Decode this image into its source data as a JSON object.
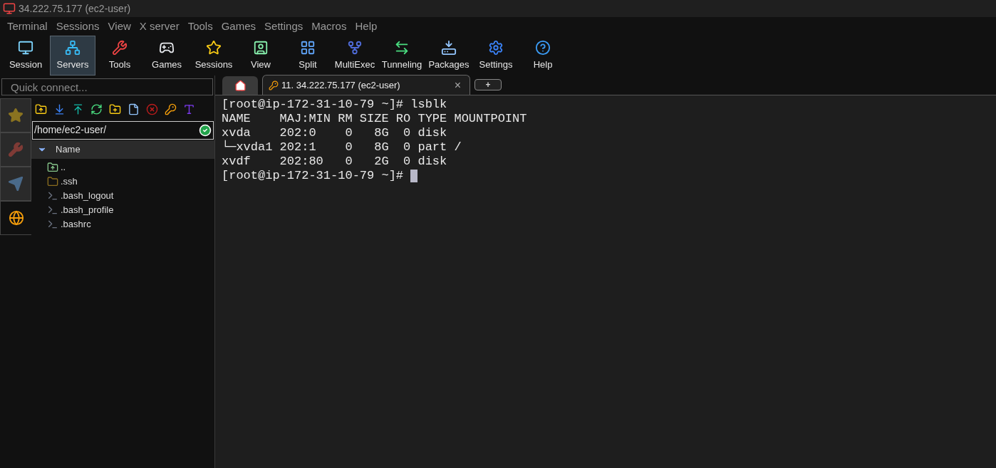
{
  "window": {
    "title": "34.222.75.177 (ec2-user)"
  },
  "menu": [
    "Terminal",
    "Sessions",
    "View",
    "X server",
    "Tools",
    "Games",
    "Settings",
    "Macros",
    "Help"
  ],
  "toolbar": [
    {
      "kind": "session",
      "label": "Session",
      "selected": false
    },
    {
      "kind": "servers",
      "label": "Servers",
      "selected": true
    },
    {
      "kind": "tools",
      "label": "Tools",
      "selected": false
    },
    {
      "kind": "games",
      "label": "Games",
      "selected": false
    },
    {
      "kind": "sessions",
      "label": "Sessions",
      "selected": false
    },
    {
      "kind": "view",
      "label": "View",
      "selected": false
    },
    {
      "kind": "split",
      "label": "Split",
      "selected": false
    },
    {
      "kind": "multiexec",
      "label": "MultiExec",
      "selected": false
    },
    {
      "kind": "tunneling",
      "label": "Tunneling",
      "selected": false
    },
    {
      "kind": "packages",
      "label": "Packages",
      "selected": false
    },
    {
      "kind": "settings",
      "label": "Settings",
      "selected": false
    },
    {
      "kind": "help",
      "label": "Help",
      "selected": false
    }
  ],
  "quick_connect": {
    "placeholder": "Quick connect..."
  },
  "side_tabs": [
    {
      "kind": "star",
      "selected": false
    },
    {
      "kind": "tools",
      "selected": false
    },
    {
      "kind": "send",
      "selected": false
    },
    {
      "kind": "globe",
      "selected": true
    }
  ],
  "file_browser": {
    "path": "/home/ec2-user/",
    "column": "Name",
    "files": [
      {
        "kind": "parent",
        "name": ".."
      },
      {
        "kind": "folder",
        "name": ".ssh"
      },
      {
        "kind": "file",
        "name": ".bash_logout"
      },
      {
        "kind": "file",
        "name": ".bash_profile"
      },
      {
        "kind": "file",
        "name": ".bashrc"
      }
    ]
  },
  "tabs": [
    {
      "kind": "home",
      "selected": false
    },
    {
      "kind": "session",
      "label": "11. 34.222.75.177 (ec2-user)",
      "close": "×",
      "selected": true
    },
    {
      "kind": "new",
      "label": "+",
      "selected": false
    }
  ],
  "terminal": {
    "lines": [
      "[root@ip-172-31-10-79 ~]# lsblk",
      "NAME    MAJ:MIN RM SIZE RO TYPE MOUNTPOINT",
      "xvda    202:0    0   8G  0 disk",
      "└─xvda1 202:1    0   8G  0 part /",
      "xvdf    202:80   0   2G  0 disk",
      "[root@ip-172-31-10-79 ~]# "
    ],
    "cursor": true
  }
}
